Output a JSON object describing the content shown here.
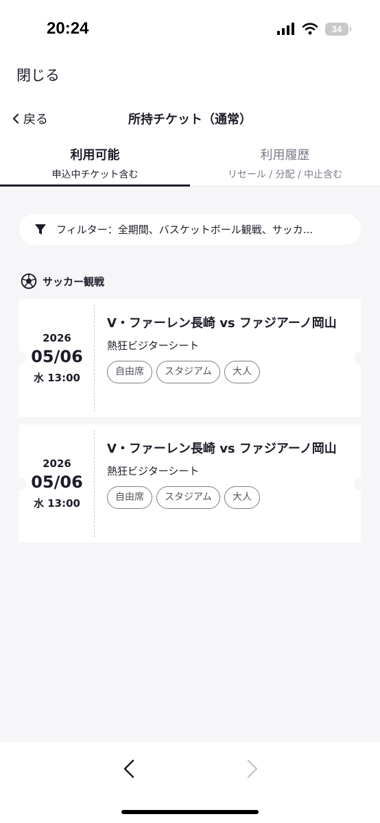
{
  "status_bar": {
    "time": "20:24",
    "battery": "34"
  },
  "top_bar": {
    "close_label": "閉じる"
  },
  "header": {
    "back_label": "戻る",
    "title": "所持チケット（通常）"
  },
  "tabs": [
    {
      "label": "利用可能",
      "sub": "申込中チケット含む",
      "active": true
    },
    {
      "label": "利用履歴",
      "sub": "リセール / 分配 / 中止含む",
      "active": false
    }
  ],
  "filter": {
    "text": "フィルター：全期間、バスケットボール観戦、サッカ..."
  },
  "section": {
    "label": "サッカー観戦",
    "icon": "soccer-ball-icon"
  },
  "tickets": [
    {
      "year": "2026",
      "date": "05/06",
      "time": "水 13:00",
      "match": "V・ファーレン長崎 vs ファジアーノ岡山",
      "seat": "熱狂ビジターシート",
      "tags": [
        "自由席",
        "スタジアム",
        "大人"
      ]
    },
    {
      "year": "2026",
      "date": "05/06",
      "time": "水 13:00",
      "match": "V・ファーレン長崎 vs ファジアーノ岡山",
      "seat": "熱狂ビジターシート",
      "tags": [
        "自由席",
        "スタジアム",
        "大人"
      ]
    }
  ],
  "colors": {
    "text": "#1c1c28",
    "muted": "#7a7a88",
    "background": "#f6f6f9",
    "card": "#ffffff"
  }
}
